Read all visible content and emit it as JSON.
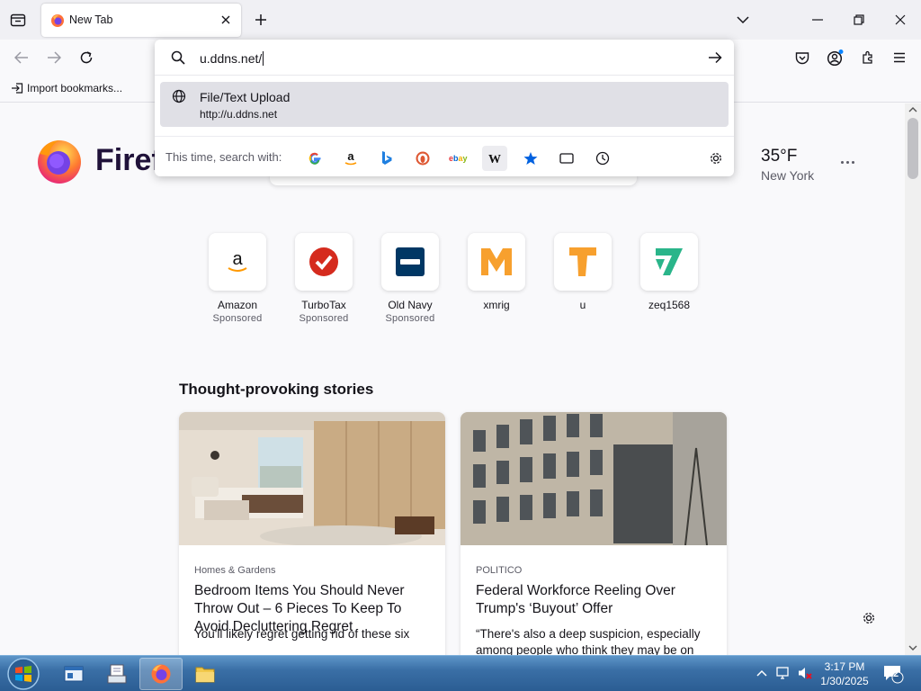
{
  "tab": {
    "title": "New Tab"
  },
  "bookmarks": {
    "import_label": "Import bookmarks..."
  },
  "urlbar": {
    "value": "u.ddns.net/",
    "suggestion_title": "File/Text Upload",
    "suggestion_url": "http://u.ddns.net",
    "search_with_label": "This time, search with:",
    "engines": [
      "google-icon",
      "amazon-icon",
      "bing-icon",
      "duckduckgo-icon",
      "ebay-icon",
      "wikipedia-icon",
      "bookmarks-icon",
      "tabs-icon",
      "history-icon"
    ]
  },
  "brand": {
    "wordmark": "Firef"
  },
  "weather": {
    "temp": "35°F",
    "city": "New York"
  },
  "shortcuts": [
    {
      "title": "Amazon",
      "sponsored": "Sponsored"
    },
    {
      "title": "TurboTax",
      "sponsored": "Sponsored"
    },
    {
      "title": "Old Navy",
      "sponsored": "Sponsored"
    },
    {
      "title": "xmrig",
      "sponsored": ""
    },
    {
      "title": "u",
      "sponsored": ""
    },
    {
      "title": "zeq1568",
      "sponsored": ""
    }
  ],
  "stories": {
    "heading": "Thought-provoking stories",
    "cards": [
      {
        "source": "Homes & Gardens",
        "title": "Bedroom Items You Should Never Throw Out – 6 Pieces To Keep To Avoid Decluttering Regret",
        "excerpt": "You'll likely regret getting rid of these six"
      },
      {
        "source": "POLITICO",
        "title": "Federal Workforce Reeling Over Trump's ‘Buyout’ Offer",
        "excerpt": "“There's also a deep suspicion, especially among people who think they may be on"
      }
    ]
  },
  "taskbar": {
    "time": "3:17 PM",
    "date": "1/30/2025",
    "notifications": "2"
  },
  "colors": {
    "accent": "#0061e0",
    "tab_strip": "#f0f0f4",
    "taskbar": "#3a6fa6"
  }
}
